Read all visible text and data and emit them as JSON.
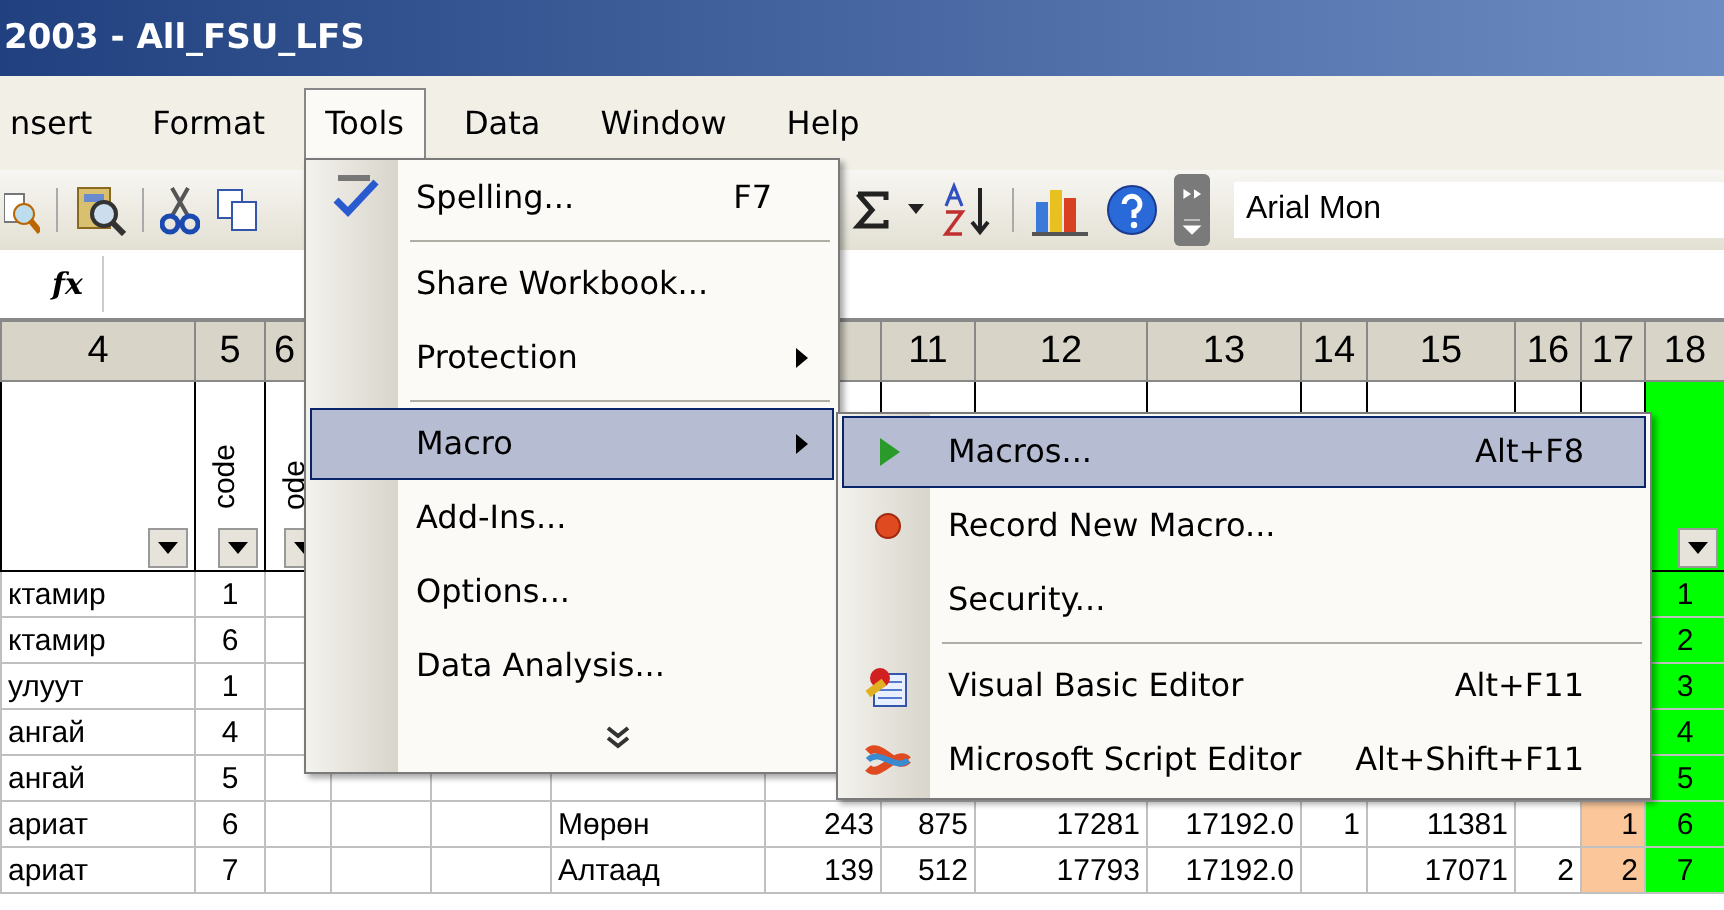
{
  "window": {
    "title": "2003 - All_FSU_LFS"
  },
  "menubar": [
    {
      "label": "nsert",
      "selected": false
    },
    {
      "label": "Format",
      "selected": false
    },
    {
      "label": "Tools",
      "selected": true
    },
    {
      "label": "Data",
      "selected": false
    },
    {
      "label": "Window",
      "selected": false
    },
    {
      "label": "Help",
      "selected": false
    }
  ],
  "toolbar": {
    "font_box": {
      "value": "Arial Mon"
    }
  },
  "formula_bar": {
    "label": "fx"
  },
  "sheet": {
    "columns": [
      {
        "label": "4",
        "filter": true
      },
      {
        "label": "5",
        "filter": true,
        "heading": "code"
      },
      {
        "label": "6",
        "filter": true,
        "heading": "ode"
      },
      {},
      {},
      {},
      {},
      {
        "label": "11"
      },
      {
        "label": "12"
      },
      {
        "label": "13"
      },
      {
        "label": "14"
      },
      {
        "label": "15"
      },
      {
        "label": "16"
      },
      {
        "label": "17"
      },
      {
        "label": "18",
        "filter": true,
        "color": "#00ff00"
      }
    ],
    "rows": [
      [
        "ктамир",
        "1",
        null,
        null,
        null,
        null,
        null,
        null,
        null,
        null,
        null,
        null,
        null,
        null,
        "1"
      ],
      [
        "ктамир",
        "6",
        null,
        null,
        null,
        null,
        null,
        null,
        null,
        null,
        null,
        null,
        null,
        null,
        "2"
      ],
      [
        "улуут",
        "1",
        null,
        null,
        null,
        null,
        null,
        null,
        null,
        null,
        null,
        null,
        null,
        null,
        "3"
      ],
      [
        "ангай",
        "4",
        null,
        null,
        null,
        null,
        null,
        null,
        null,
        null,
        null,
        null,
        null,
        null,
        "4"
      ],
      [
        "ангай",
        "5",
        null,
        null,
        null,
        null,
        null,
        null,
        null,
        null,
        null,
        null,
        null,
        null,
        "5"
      ],
      [
        "ариат",
        "6",
        null,
        null,
        null,
        "Мөрөн",
        "243",
        "875",
        "17281",
        "17192.0",
        "1",
        "11381",
        null,
        {
          "text": "1",
          "color": "#fbc79a"
        },
        "6"
      ],
      [
        "ариат",
        "7",
        null,
        null,
        null,
        "Алтаад",
        "139",
        "512",
        "17793",
        "17192.0",
        null,
        "17071",
        "2",
        {
          "text": "2",
          "color": "#fbc79a"
        },
        "7"
      ]
    ]
  },
  "tools_menu": [
    {
      "kind": "spelling",
      "label": "Spelling...",
      "shortcut": "F7",
      "selected": false
    },
    {
      "kind": "separator"
    },
    {
      "kind": "plain",
      "label": "Share Workbook...",
      "selected": false
    },
    {
      "kind": "plain",
      "label": "Protection",
      "submenu": true,
      "selected": false
    },
    {
      "kind": "separator"
    },
    {
      "kind": "plain",
      "label": "Macro",
      "submenu": true,
      "selected": true
    },
    {
      "kind": "plain",
      "label": "Add-Ins...",
      "selected": false
    },
    {
      "kind": "plain",
      "label": "Options...",
      "selected": false
    },
    {
      "kind": "plain",
      "label": "Data Analysis...",
      "selected": false
    },
    {
      "kind": "more"
    }
  ],
  "macro_submenu": [
    {
      "kind": "run",
      "label": "Macros...",
      "shortcut": "Alt+F8",
      "selected": true
    },
    {
      "kind": "record",
      "label": "Record New Macro...",
      "selected": false
    },
    {
      "kind": "plain",
      "label": "Security...",
      "selected": false
    },
    {
      "kind": "separator"
    },
    {
      "kind": "vb",
      "label": "Visual Basic Editor",
      "shortcut": "Alt+F11",
      "selected": false
    },
    {
      "kind": "script",
      "label": "Microsoft Script Editor",
      "shortcut": "Alt+Shift+F11",
      "selected": false
    }
  ]
}
